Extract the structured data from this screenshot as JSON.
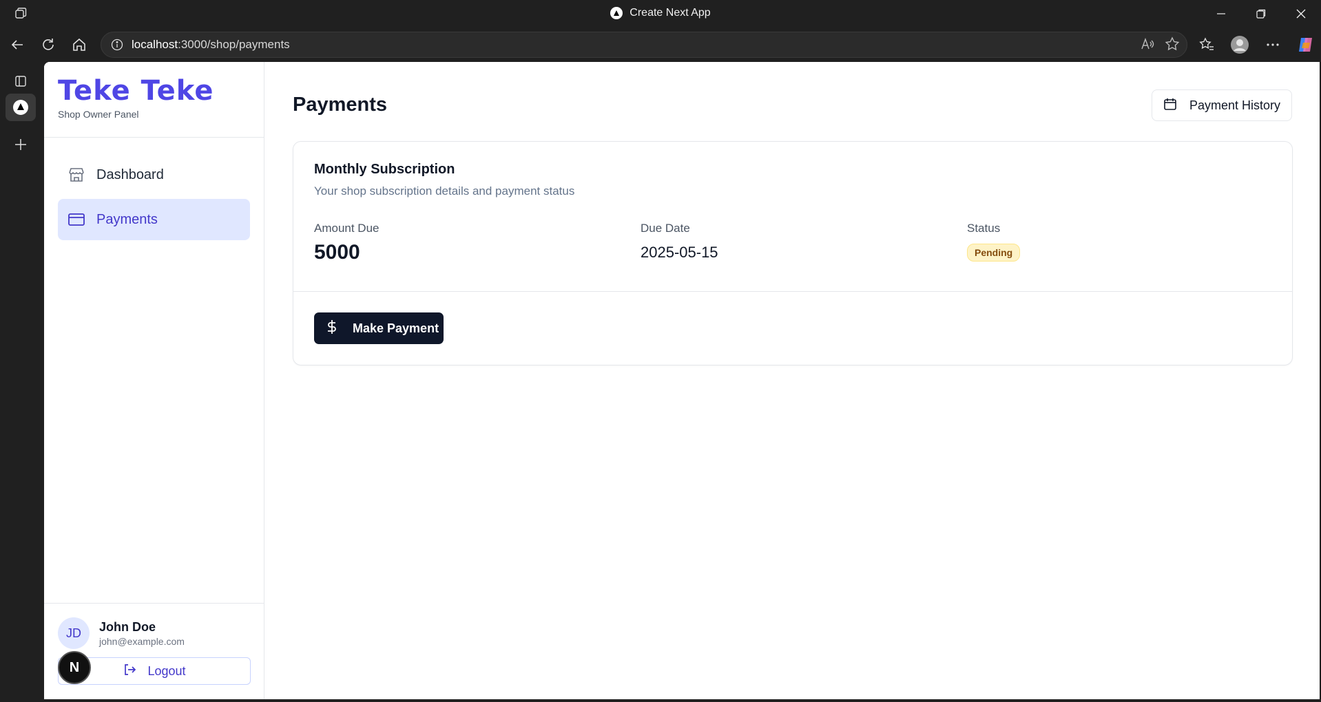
{
  "browser": {
    "tab_title": "Create Next App",
    "url_host": "localhost",
    "url_rest": ":3000/shop/payments"
  },
  "sidebar": {
    "brand_title": "Teke Teke",
    "brand_subtitle": "Shop Owner Panel",
    "items": [
      {
        "label": "Dashboard",
        "icon": "store-icon",
        "active": false
      },
      {
        "label": "Payments",
        "icon": "credit-card-icon",
        "active": true
      }
    ],
    "user": {
      "initials": "JD",
      "name": "John Doe",
      "email": "john@example.com"
    },
    "logout_label": "Logout",
    "next_badge": "N"
  },
  "main": {
    "title": "Payments",
    "history_button": "Payment History",
    "card": {
      "title": "Monthly Subscription",
      "description": "Your shop subscription details and payment status",
      "amount_label": "Amount Due",
      "amount_value": "5000",
      "due_label": "Due Date",
      "due_value": "2025-05-15",
      "status_label": "Status",
      "status_value": "Pending",
      "pay_button": "Make Payment"
    }
  },
  "colors": {
    "brand": "#4f46e5",
    "active_nav_bg": "#e0e7ff",
    "primary_button": "#0f172a",
    "pending_badge_bg": "#fef3c7"
  }
}
